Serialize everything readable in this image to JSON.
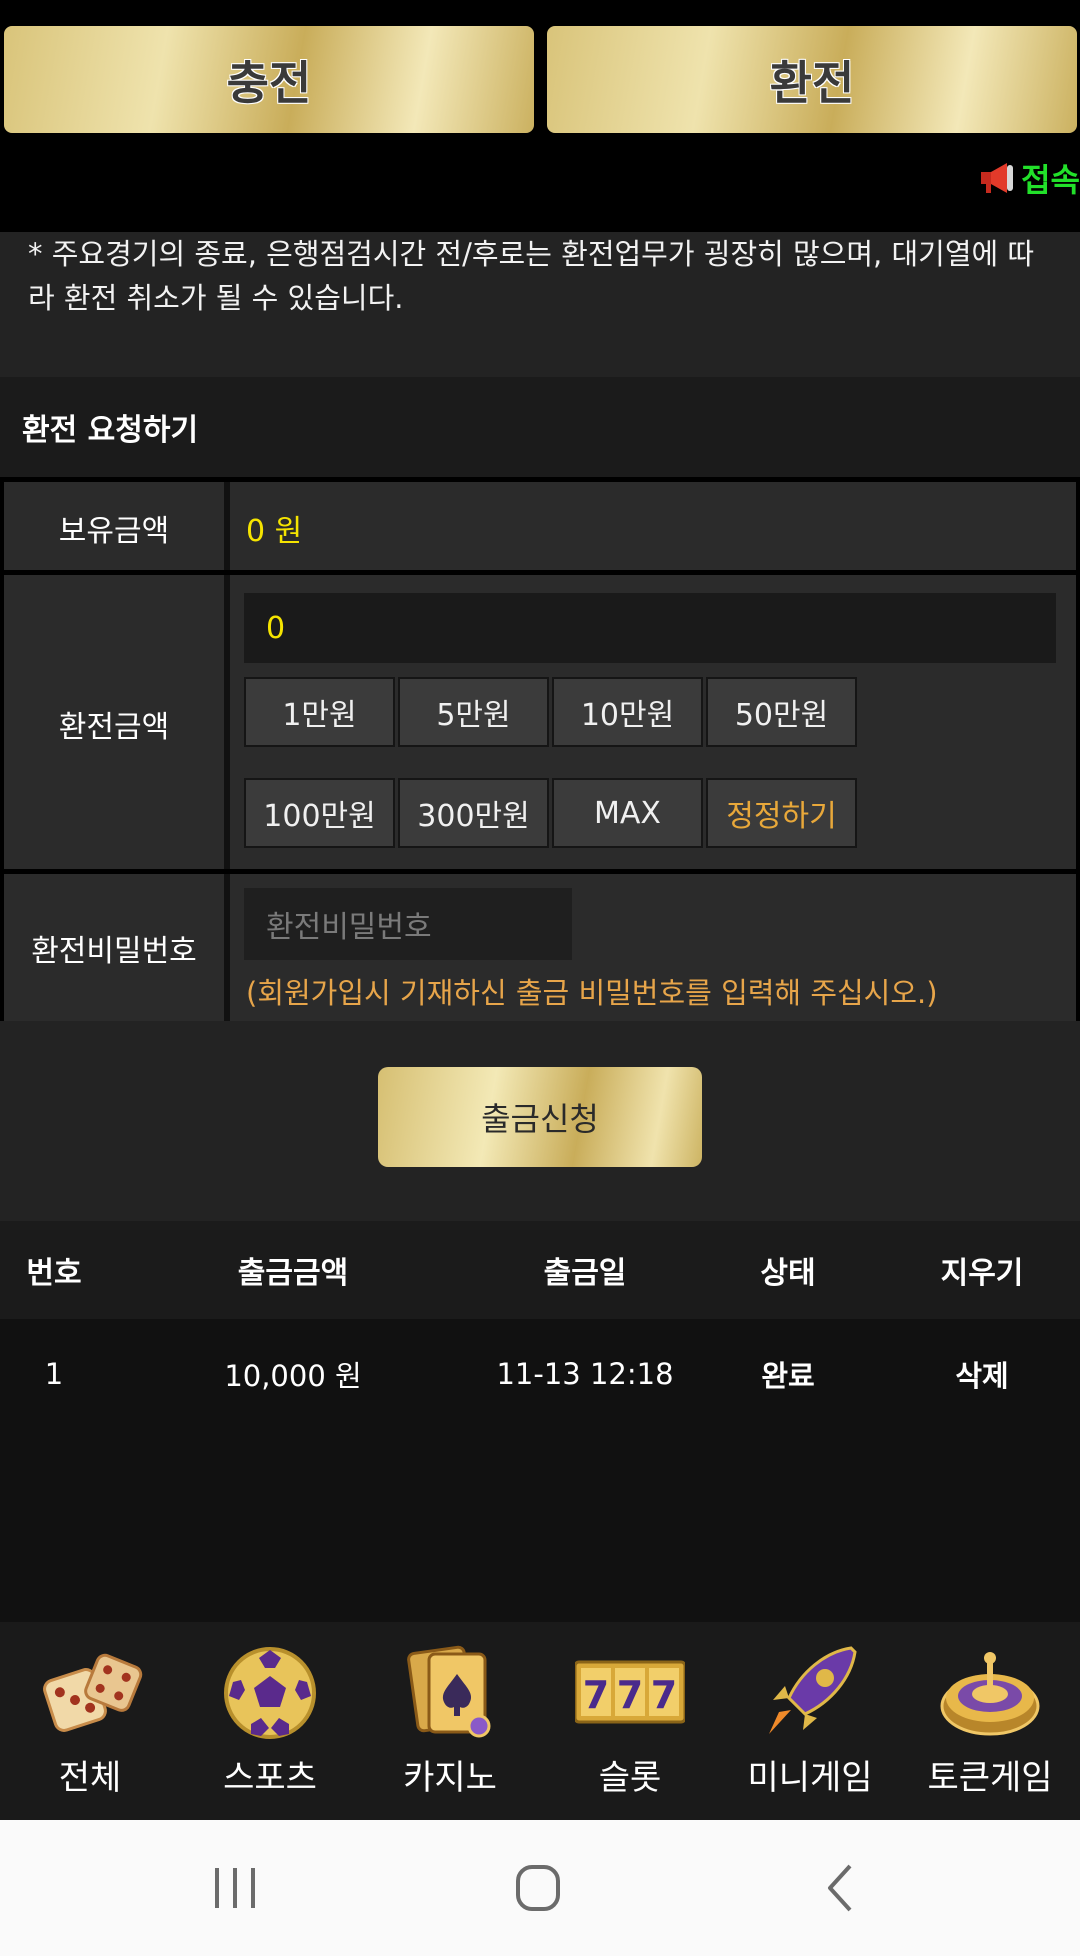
{
  "header": {
    "charge_label": "충전",
    "exchange_label": "환전",
    "ticker_text": "접속"
  },
  "notice": {
    "text": "* 주요경기의 종료, 은행점검시간 전/후로는 환전업무가 굉장히 많으며, 대기열에 따라 환전 취소가 될 수 있습니다."
  },
  "form": {
    "title": "환전 요청하기",
    "balance_label": "보유금액",
    "balance_value": "0 원",
    "amount_label": "환전금액",
    "amount_value": "0",
    "amount_buttons": [
      "1만원",
      "5만원",
      "10만원",
      "50만원",
      "100만원",
      "300만원",
      "MAX",
      "정정하기"
    ],
    "password_label": "환전비밀번호",
    "password_placeholder": "환전비밀번호",
    "password_hint": "(회원가입시 기재하신 출금 비밀번호를 입력해 주십시오.)",
    "submit_label": "출금신청"
  },
  "history": {
    "columns": [
      "번호",
      "출금금액",
      "출금일",
      "상태",
      "지우기"
    ],
    "rows": [
      {
        "no": "1",
        "amount": "10,000 원",
        "date": "11-13 12:18",
        "status": "완료",
        "action": "삭제"
      }
    ]
  },
  "bottom_nav": {
    "items": [
      {
        "label": "전체",
        "icon": "dice-icon"
      },
      {
        "label": "스포츠",
        "icon": "soccer-ball-icon"
      },
      {
        "label": "카지노",
        "icon": "playing-cards-icon"
      },
      {
        "label": "슬롯",
        "icon": "slot-777-icon"
      },
      {
        "label": "미니게임",
        "icon": "rocket-icon"
      },
      {
        "label": "토큰게임",
        "icon": "roulette-icon"
      }
    ]
  },
  "colors": {
    "gold": "#e6d492",
    "yellow_value": "#f5e400",
    "orange_hint": "#e7a54a",
    "ticker_green": "#22e02a"
  }
}
